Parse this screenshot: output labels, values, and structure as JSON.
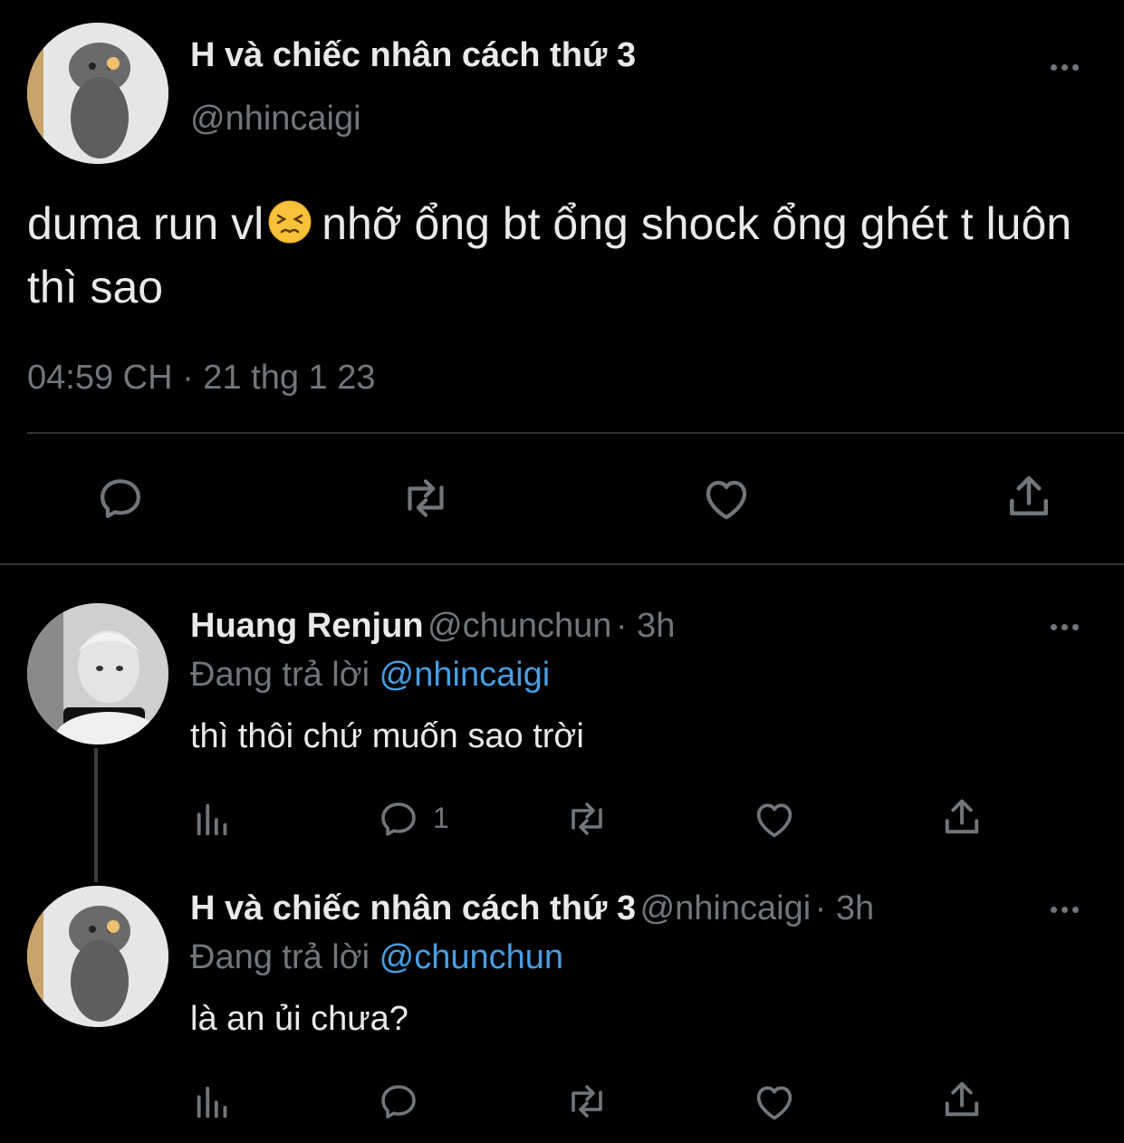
{
  "main_tweet": {
    "author_name": "H và chiếc nhân cách thứ 3",
    "handle": "@nhincaigi",
    "text_before_emoji": "duma run vl",
    "emoji_name": "persevering-face-emoji",
    "text_after_emoji": "nhỡ ổng bt ổng shock ổng ghét t luôn thì sao",
    "timestamp": "04:59 CH · 21 thg 1 23",
    "actions": [
      "reply-icon",
      "retweet-icon",
      "like-icon",
      "share-icon"
    ]
  },
  "replies": [
    {
      "author_name": "Huang Renjun",
      "handle": "@chunchun",
      "time": "· 3h",
      "replying_prefix": "Đang trả lời",
      "replying_to": "@nhincaigi",
      "text": "thì thôi chứ muốn sao trời",
      "reply_count": "1"
    },
    {
      "author_name": "H và chiếc nhân cách thứ 3",
      "handle": "@nhincaigi",
      "time": "· 3h",
      "replying_prefix": "Đang trả lời",
      "replying_to": "@chunchun",
      "text": "là an ủi chưa?",
      "reply_count": ""
    }
  ],
  "colors": {
    "background": "#000000",
    "text": "#e7e9ea",
    "muted": "#71767b",
    "link": "#4a9de0",
    "divider": "#2f3336"
  }
}
